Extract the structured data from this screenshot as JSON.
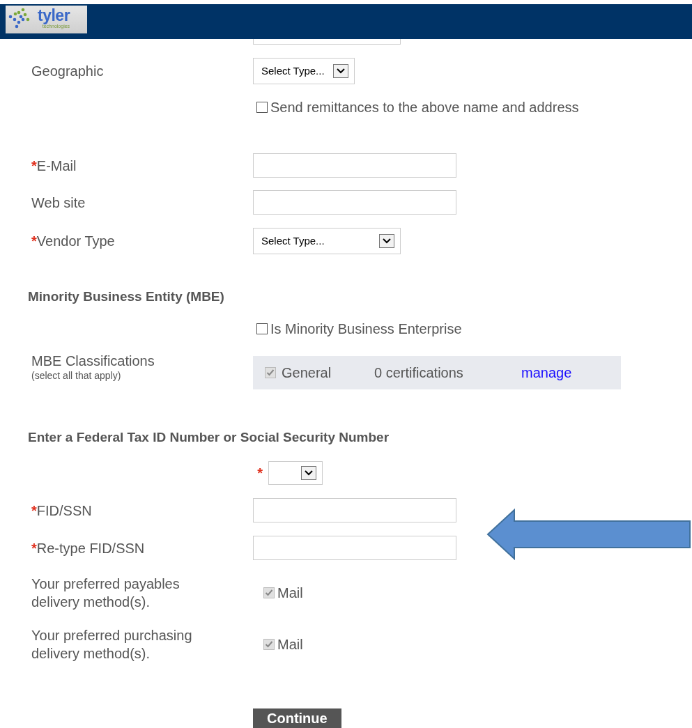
{
  "header": {
    "logo": {
      "name": "tyler",
      "tagline": "technologies"
    }
  },
  "rows": [
    {
      "kind": "cut_field"
    },
    {
      "kind": "select",
      "label": "Geographic",
      "required": false,
      "value": "Select Type..."
    },
    {
      "kind": "checkbox",
      "text": "Send remittances to the above name and address",
      "checked": false
    },
    {
      "kind": "input",
      "label": "E-Mail",
      "required": true,
      "marker": "*"
    },
    {
      "kind": "input",
      "label": "Web site",
      "required": false
    },
    {
      "kind": "select",
      "label": "Vendor Type",
      "required": true,
      "marker": "*",
      "value": "Select Type..."
    },
    {
      "kind": "heading",
      "text": "Minority Business Entity (MBE)"
    },
    {
      "kind": "checkbox",
      "text": "Is Minority Business Enterprise",
      "checked": false
    },
    {
      "kind": "classifications",
      "label": "MBE Classifications",
      "hint": "(select all that apply)",
      "item": {
        "name": "General",
        "checked": true,
        "disabled": true,
        "count": "0 certifications",
        "link": "manage"
      }
    },
    {
      "kind": "heading",
      "text": "Enter a Federal Tax ID Number or Social Security Number"
    },
    {
      "kind": "select",
      "label": "",
      "required": true,
      "marker": "*",
      "value": ""
    },
    {
      "kind": "input",
      "label": "FID/SSN",
      "required": true,
      "marker": "*"
    },
    {
      "kind": "input",
      "label": "Re-type FID/SSN",
      "required": true,
      "marker": "*"
    },
    {
      "kind": "delivery",
      "label": "Your preferred payables delivery method(s).",
      "option": "Mail",
      "checked": true,
      "disabled": true
    },
    {
      "kind": "delivery",
      "label": "Your preferred purchasing delivery method(s).",
      "option": "Mail",
      "checked": true,
      "disabled": true
    },
    {
      "kind": "button",
      "text": "Continue"
    }
  ]
}
